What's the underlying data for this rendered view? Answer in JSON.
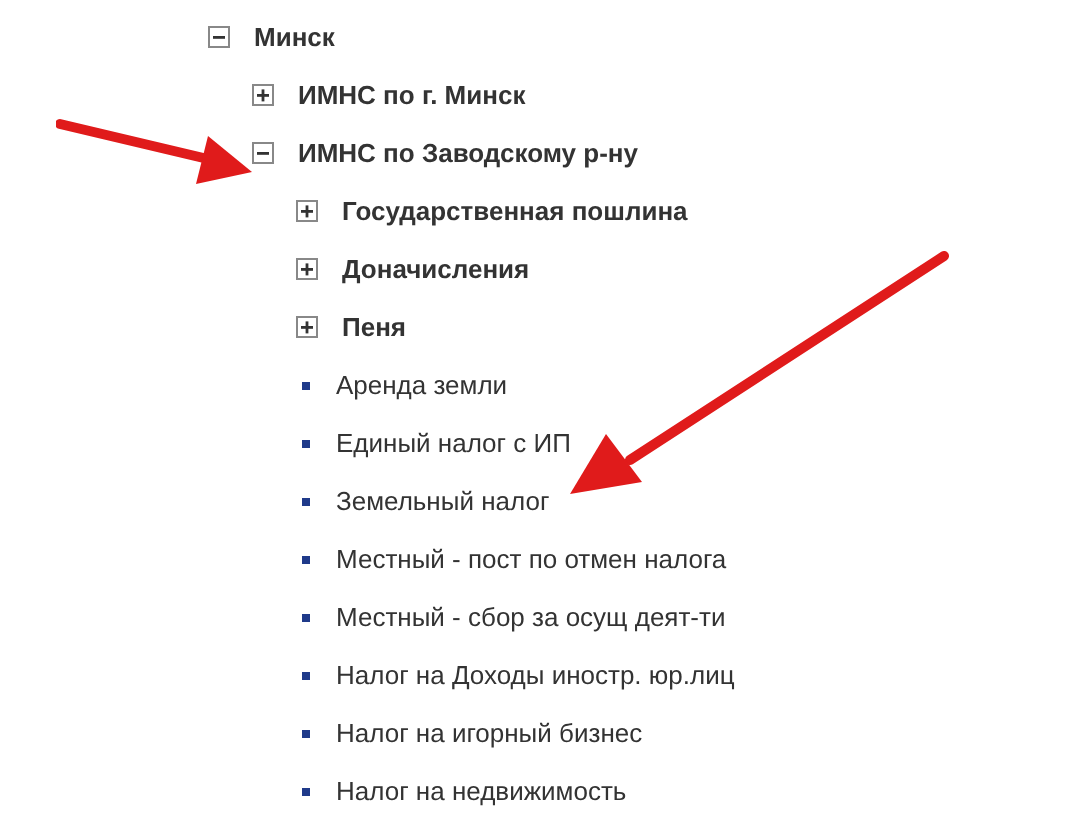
{
  "tree": [
    {
      "kind": "folder",
      "label": "Минск",
      "expanded": true,
      "children": [
        {
          "kind": "folder",
          "label": "ИМНС по г. Минск",
          "expanded": false
        },
        {
          "kind": "folder",
          "label": "ИМНС по Заводскому р-ну",
          "expanded": true,
          "children": [
            {
              "kind": "folder",
              "label": "Государственная пошлина",
              "expanded": false
            },
            {
              "kind": "folder",
              "label": "Доначисления",
              "expanded": false
            },
            {
              "kind": "folder",
              "label": "Пеня",
              "expanded": false
            },
            {
              "kind": "leaf",
              "label": "Аренда земли"
            },
            {
              "kind": "leaf",
              "label": "Единый налог с ИП"
            },
            {
              "kind": "leaf",
              "label": "Земельный налог"
            },
            {
              "kind": "leaf",
              "label": "Местный - пост по отмен налога"
            },
            {
              "kind": "leaf",
              "label": "Местный - сбор за осущ деят-ти"
            },
            {
              "kind": "leaf",
              "label": "Налог на Доходы иностр. юр.лиц"
            },
            {
              "kind": "leaf",
              "label": "Налог на игорный бизнес"
            },
            {
              "kind": "leaf",
              "label": "Налог на недвижимость"
            }
          ]
        }
      ]
    }
  ]
}
